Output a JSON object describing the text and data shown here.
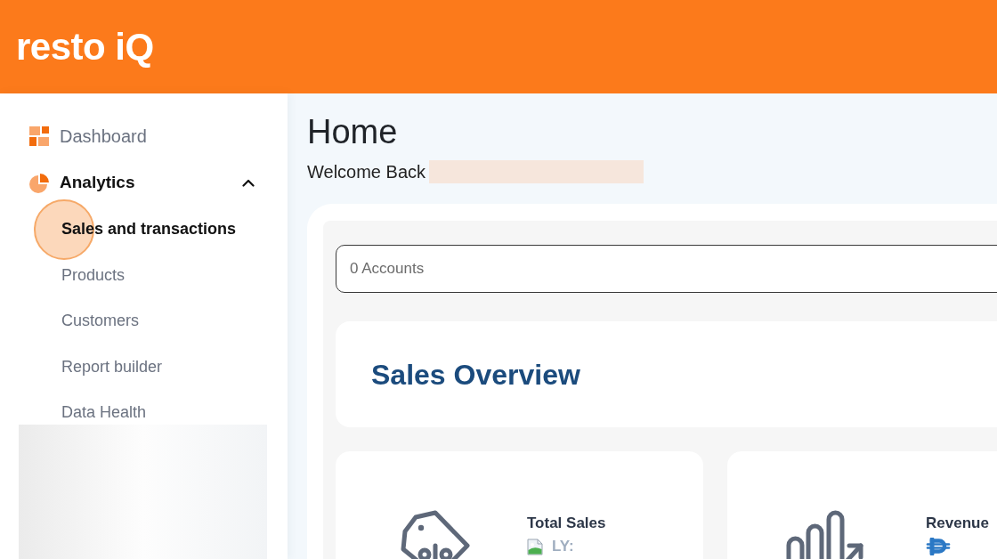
{
  "header": {
    "logo": "resto iQ"
  },
  "sidebar": {
    "items": [
      {
        "kind": "link",
        "label": "Dashboard",
        "selected": false
      },
      {
        "kind": "group",
        "label": "Analytics",
        "selected": true,
        "expanded": true,
        "children": [
          {
            "label": "Sales and transactions",
            "selected": true,
            "clicked": true
          },
          {
            "label": "Products",
            "selected": false,
            "clicked": false
          },
          {
            "label": "Customers",
            "selected": false,
            "clicked": false
          },
          {
            "label": "Report builder",
            "selected": false,
            "clicked": false
          },
          {
            "label": "Data Health",
            "selected": false,
            "clicked": false
          }
        ]
      }
    ],
    "footer_blurred": true
  },
  "page": {
    "title": "Home",
    "welcome": "Welcome Back",
    "name_blurred": true
  },
  "account_filter": {
    "value": "0 Accounts"
  },
  "sales_overview": {
    "title": "Sales Overview",
    "cards": [
      {
        "kind": "sales",
        "title": "Total Sales",
        "comparison": "LY:"
      },
      {
        "kind": "revenue",
        "title": "Revenue"
      }
    ]
  }
}
